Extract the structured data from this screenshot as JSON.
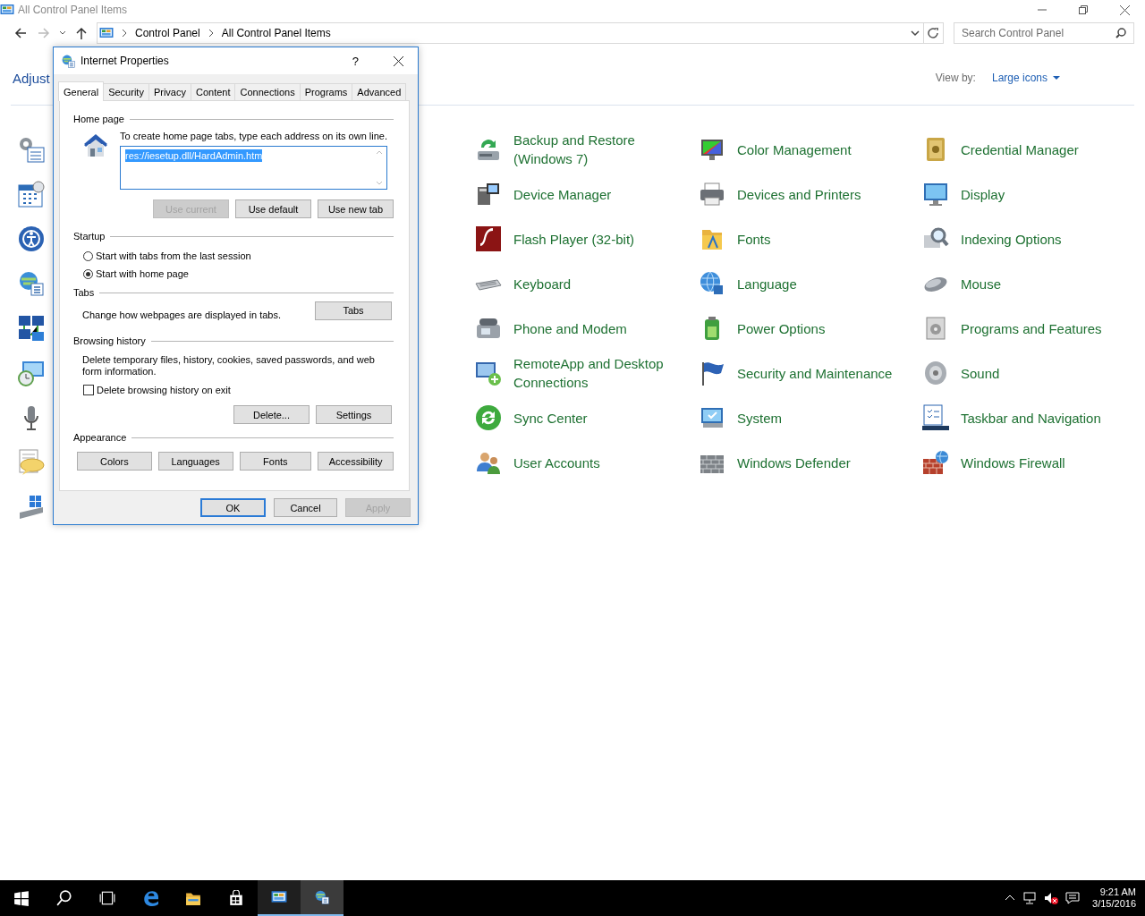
{
  "window": {
    "title": "All Control Panel Items"
  },
  "address_bar": {
    "breadcrumbs": [
      "Control Panel",
      "All Control Panel Items"
    ]
  },
  "search": {
    "placeholder": "Search Control Panel"
  },
  "header": {
    "heading": "Adjust",
    "view_by_label": "View by:",
    "view_by_value": "Large icons"
  },
  "items": [
    "Backup and Restore (Windows 7)",
    "Color Management",
    "Credential Manager",
    "Device Manager",
    "Devices and Printers",
    "Display",
    "Flash Player (32-bit)",
    "Fonts",
    "Indexing Options",
    "Keyboard",
    "Language",
    "Mouse",
    "Phone and Modem",
    "Power Options",
    "Programs and Features",
    "RemoteApp and Desktop Connections",
    "Security and Maintenance",
    "Sound",
    "Sync Center",
    "System",
    "Taskbar and Navigation",
    "User Accounts",
    "Windows Defender",
    "Windows Firewall"
  ],
  "dialog": {
    "title": "Internet Properties",
    "help": "?",
    "tabs": [
      {
        "label": "General",
        "selected": true
      },
      {
        "label": "Security",
        "selected": false
      },
      {
        "label": "Privacy",
        "selected": false
      },
      {
        "label": "Content",
        "selected": false
      },
      {
        "label": "Connections",
        "selected": false
      },
      {
        "label": "Programs",
        "selected": false
      },
      {
        "label": "Advanced",
        "selected": false
      }
    ],
    "home_page": {
      "section": "Home page",
      "instruction": "To create home page tabs, type each address on its own line.",
      "value": "res://iesetup.dll/HardAdmin.htm",
      "value_selected": true,
      "buttons": [
        {
          "label": "Use current",
          "disabled": true
        },
        {
          "label": "Use default",
          "disabled": false
        },
        {
          "label": "Use new tab",
          "disabled": false
        }
      ]
    },
    "startup": {
      "section": "Startup",
      "options": [
        {
          "label": "Start with tabs from the last session",
          "selected": false
        },
        {
          "label": "Start with home page",
          "selected": true
        }
      ]
    },
    "tabs_section": {
      "section": "Tabs",
      "description": "Change how webpages are displayed in tabs.",
      "button": "Tabs"
    },
    "browsing_history": {
      "section": "Browsing history",
      "description": "Delete temporary files, history, cookies, saved passwords, and web form information.",
      "checkbox": {
        "label": "Delete browsing history on exit",
        "checked": false
      },
      "buttons": [
        "Delete...",
        "Settings"
      ]
    },
    "appearance": {
      "section": "Appearance",
      "buttons": [
        "Colors",
        "Languages",
        "Fonts",
        "Accessibility"
      ]
    },
    "footer_buttons": [
      {
        "label": "OK",
        "default": true,
        "disabled": false
      },
      {
        "label": "Cancel",
        "default": false,
        "disabled": false
      },
      {
        "label": "Apply",
        "default": false,
        "disabled": true
      }
    ]
  },
  "taskbar": {
    "buttons": [
      {
        "kind": "start"
      },
      {
        "kind": "search"
      },
      {
        "kind": "task-view"
      }
    ],
    "apps": [
      {
        "kind": "edge",
        "running": false,
        "selected": false
      },
      {
        "kind": "explorer",
        "running": false,
        "selected": false
      },
      {
        "kind": "store",
        "running": false,
        "selected": false
      },
      {
        "kind": "control-panel",
        "running": true,
        "selected": false
      },
      {
        "kind": "internet-options",
        "running": true,
        "selected": true
      }
    ],
    "clock": {
      "time": "9:21 AM",
      "date": "3/15/2016"
    }
  }
}
